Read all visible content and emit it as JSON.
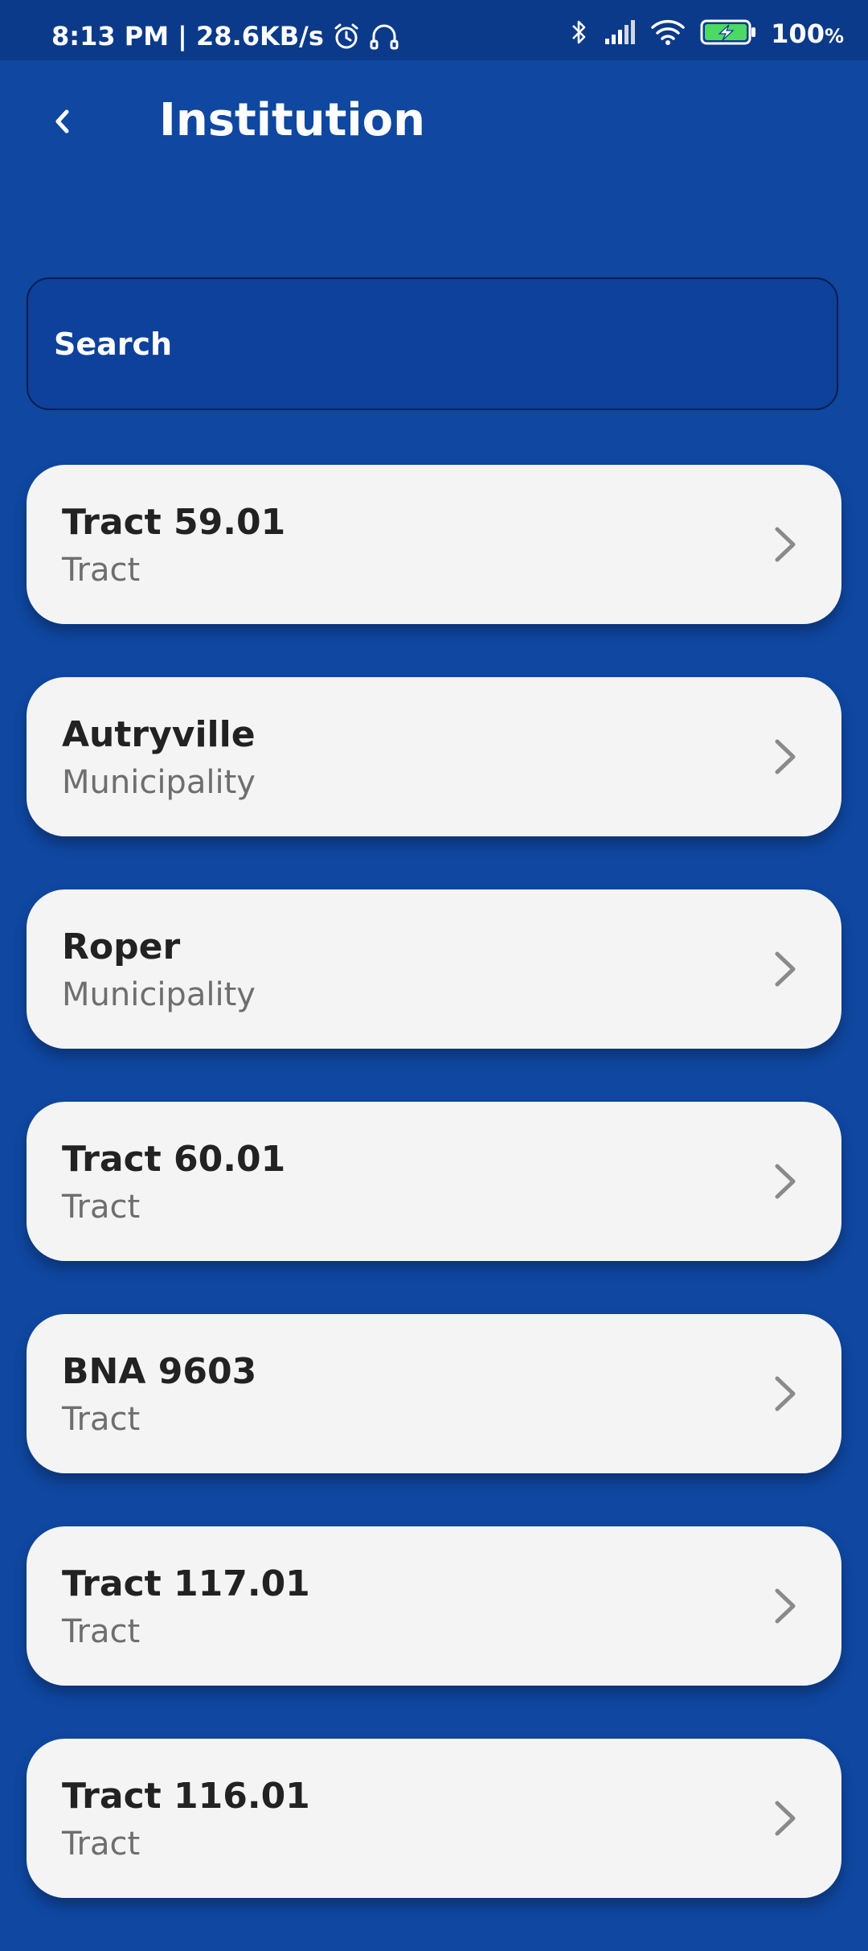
{
  "status_bar": {
    "time_speed": "8:13 PM | 28.6KB/s",
    "battery_percent": "100",
    "battery_unit": "%",
    "icons": [
      "alarm-icon",
      "headphones-icon",
      "bluetooth-icon",
      "signal-icon",
      "wifi-icon",
      "battery-charging-icon"
    ]
  },
  "header": {
    "title": "Institution",
    "back_icon": "chevron-left-icon"
  },
  "search": {
    "placeholder": "Search",
    "value": ""
  },
  "items": [
    {
      "title": "Tract 59.01",
      "subtitle": "Tract"
    },
    {
      "title": "Autryville",
      "subtitle": "Municipality"
    },
    {
      "title": "Roper",
      "subtitle": "Municipality"
    },
    {
      "title": "Tract 60.01",
      "subtitle": "Tract"
    },
    {
      "title": "BNA 9603",
      "subtitle": "Tract"
    },
    {
      "title": "Tract 117.01",
      "subtitle": "Tract"
    },
    {
      "title": "Tract 116.01",
      "subtitle": "Tract"
    }
  ],
  "colors": {
    "background": "#0f47a1",
    "status_bar": "#0c3a8a",
    "card": "#f4f4f4",
    "title_text": "#222222",
    "subtitle_text": "#6e6e6e",
    "battery_accent": "#4cd964"
  }
}
